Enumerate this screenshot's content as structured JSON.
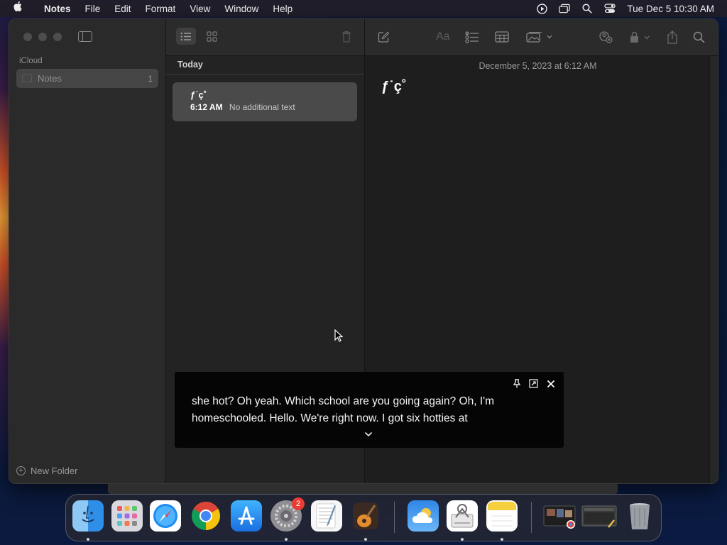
{
  "menubar": {
    "app_name": "Notes",
    "menus": [
      "File",
      "Edit",
      "Format",
      "View",
      "Window",
      "Help"
    ],
    "clock": "Tue Dec 5  10:30 AM"
  },
  "sidebar": {
    "section": "iCloud",
    "folders": [
      {
        "label": "Notes",
        "count": "1"
      }
    ],
    "new_folder": "New Folder"
  },
  "note_list": {
    "group": "Today",
    "notes": [
      {
        "title": "ƒ˙ç˚",
        "time": "6:12 AM",
        "preview": "No additional text"
      }
    ]
  },
  "editor": {
    "date": "December 5, 2023 at 6:12 AM",
    "body": "ƒ˙ç˚"
  },
  "caption": {
    "text": "she hot? Oh yeah. Which school are you going again? Oh, I'm homeschooled. Hello. We're right now. I got six hotties at"
  },
  "dock": {
    "apps": [
      "finder-icon",
      "launchpad-icon",
      "safari-icon",
      "chrome-icon",
      "app-store-icon",
      "system-settings-icon",
      "textedit-icon",
      "garageband-icon",
      "weather-icon",
      "preview-icon",
      "notes-icon",
      "recent-window-icon",
      "recent-window-icon",
      "trash-icon"
    ],
    "settings_badge": "2"
  },
  "colors": {
    "window_bg": "#232323",
    "selected_note": "#4a4a4a",
    "badge": "#ea3b35"
  }
}
